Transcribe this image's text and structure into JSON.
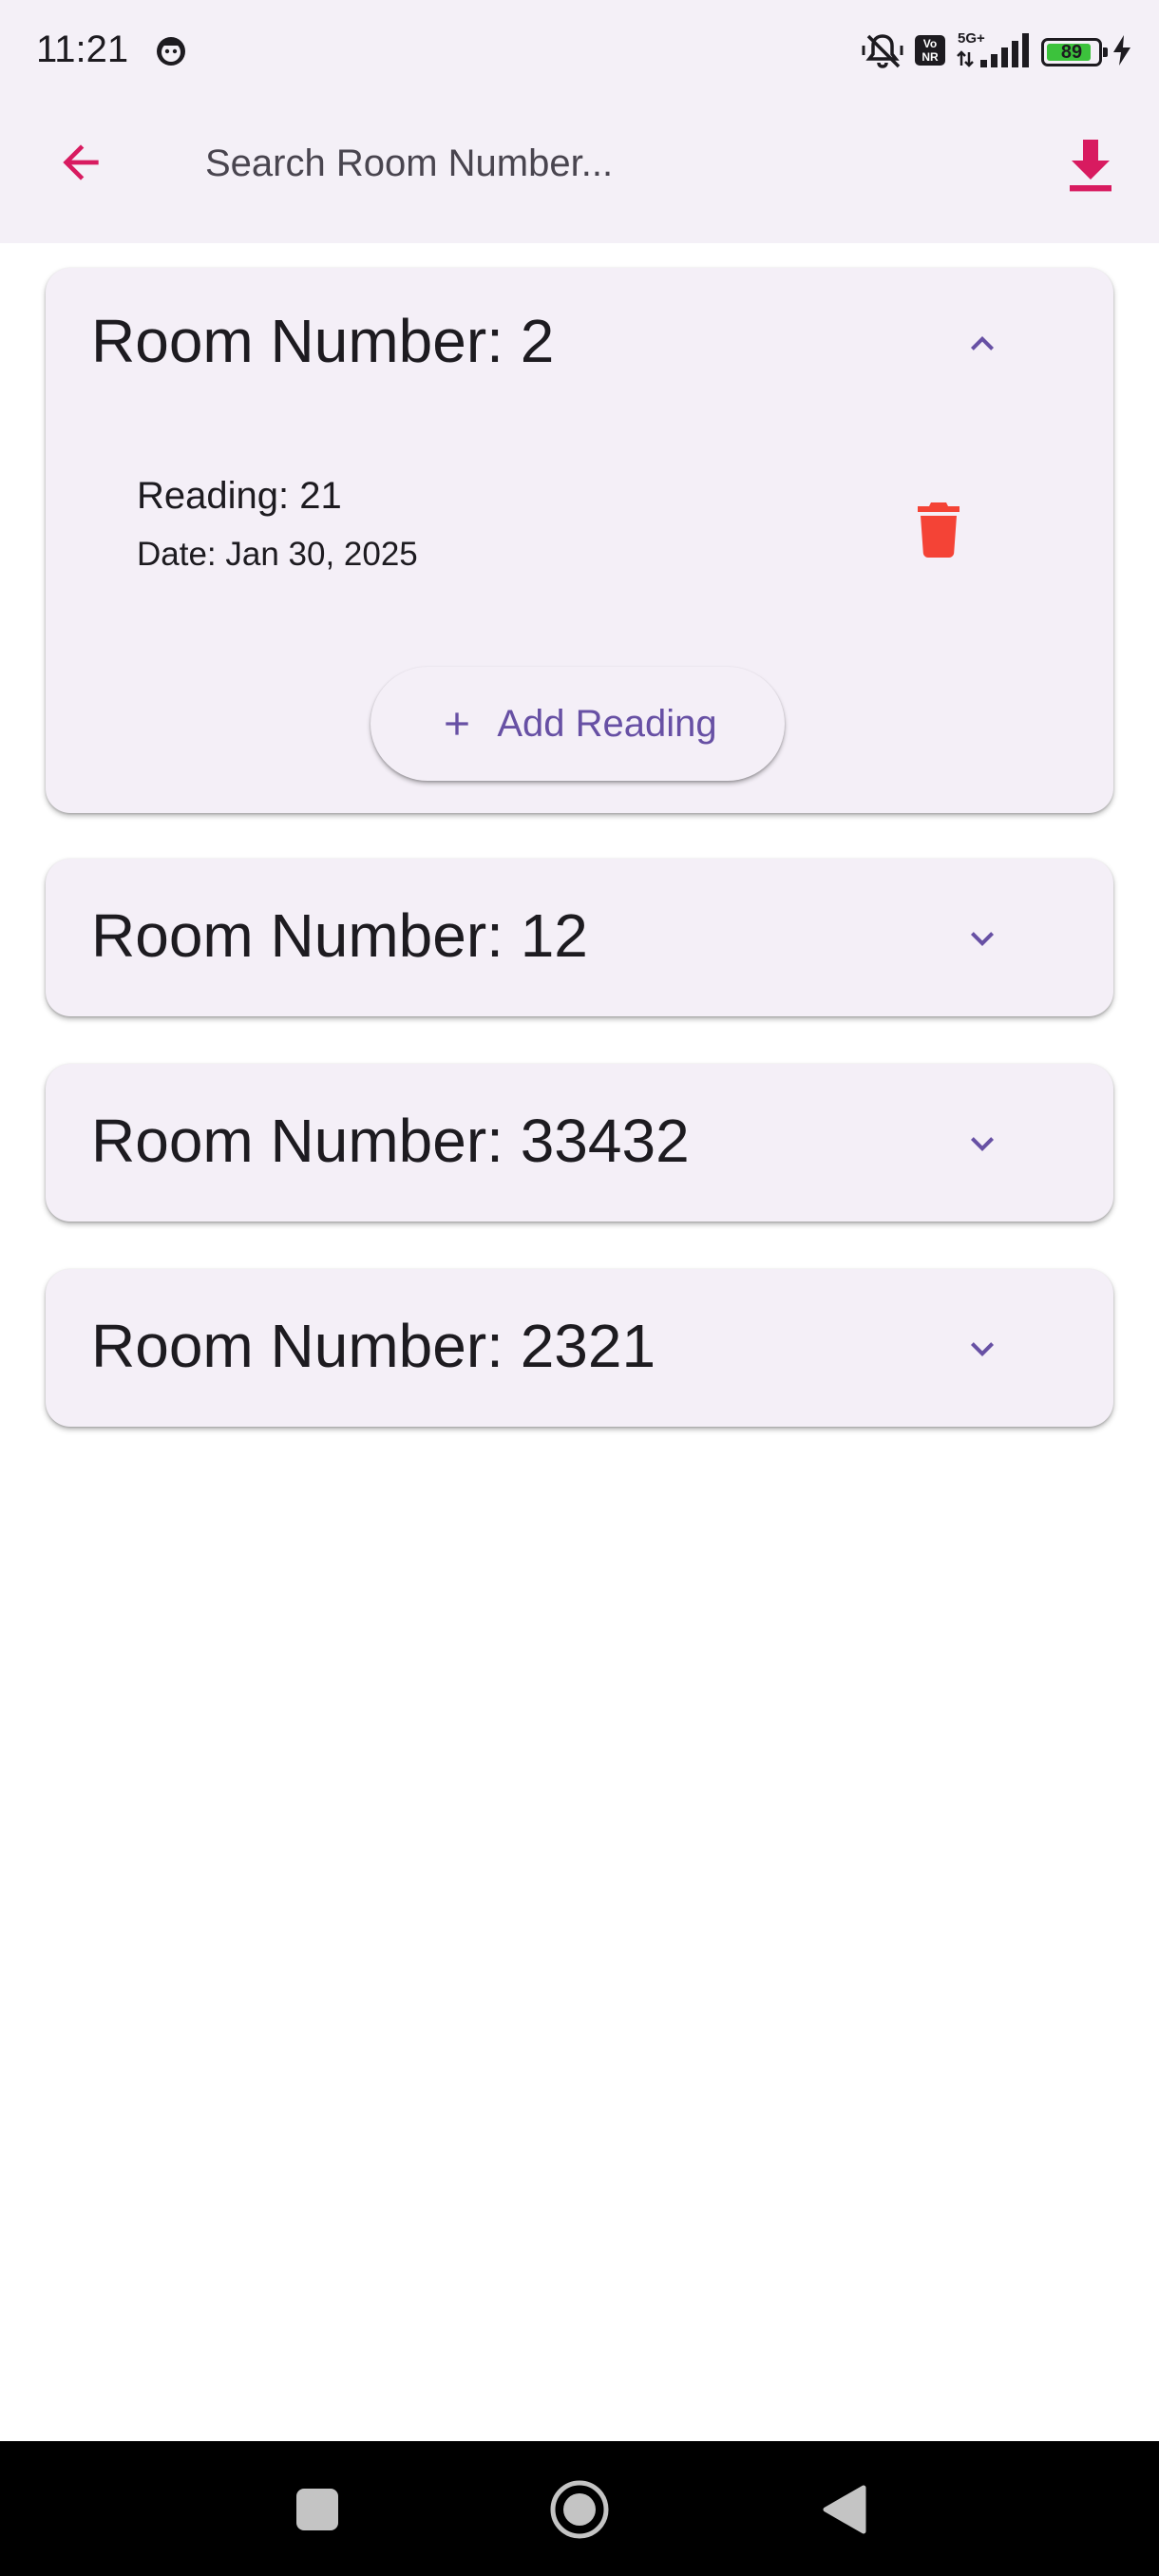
{
  "status_bar": {
    "time": "11:21",
    "battery_level": "89",
    "battery_percent": 89,
    "network": "5G+",
    "volte_badge": "Vo NR"
  },
  "app_bar": {
    "back_icon": "arrow-back-icon",
    "search_placeholder": "Search Room Number...",
    "search_value": "",
    "download_icon": "download-icon"
  },
  "colors": {
    "accent": "#d81b60",
    "primary": "#6750a4",
    "delete": "#f44336",
    "card_surface": "#f4eff7"
  },
  "rooms": [
    {
      "title": "Room Number: 2",
      "expanded": true,
      "readings": [
        {
          "reading": "Reading: 21",
          "date": "Date: Jan 30, 2025"
        }
      ],
      "add_label": "Add Reading"
    },
    {
      "title": "Room Number: 12",
      "expanded": false
    },
    {
      "title": "Room Number: 33432",
      "expanded": false
    },
    {
      "title": "Room Number: 2321",
      "expanded": false
    }
  ]
}
